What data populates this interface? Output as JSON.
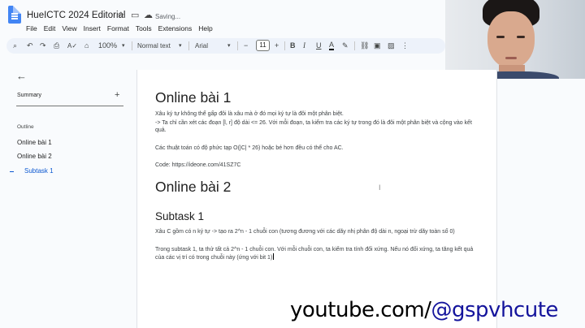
{
  "window": {
    "doc_title": "HueICTC 2024 Editorial",
    "save_status": "Saving...",
    "menu": [
      "File",
      "Edit",
      "View",
      "Insert",
      "Format",
      "Tools",
      "Extensions",
      "Help"
    ]
  },
  "toolbar": {
    "zoom": "100%",
    "style": "Normal text",
    "font": "Arial",
    "font_size": "11",
    "icons": [
      "search-icon",
      "undo-icon",
      "redo-icon",
      "print-icon",
      "spellcheck-icon",
      "paint-format-icon",
      "bold-icon",
      "italic-icon",
      "underline-icon",
      "text-color-icon",
      "highlight-icon",
      "link-icon",
      "comment-icon",
      "image-icon"
    ]
  },
  "sidebar": {
    "summary_label": "Summary",
    "outline_label": "Outline",
    "items": [
      {
        "label": "Online bài 1",
        "active": false
      },
      {
        "label": "Online bài 2",
        "active": false
      },
      {
        "label": "Subtask 1",
        "active": true
      }
    ]
  },
  "document": {
    "h1_a": "Online bài 1",
    "p1": "Xâu ký tự không thể gấp đôi là xâu mà ở đó mọi ký tự là đôi một phân biệt.",
    "p2": "-> Ta chỉ cần xét các đoạn [l, r] độ dài <= 26. Với mỗi đoạn, ta kiểm tra các ký tự trong đó là đôi một phân biệt và cộng vào kết quả.",
    "p3": "Các thuật toán có độ phức tạp O(|C| * 26) hoặc bé hơn đều có thể cho AC.",
    "p4": "Code: https://ideone.com/41SZ7C",
    "h1_b": "Online bài 2",
    "h2": "Subtask 1",
    "p5": "Xâu C gồm có n ký tự -> tạo ra 2^n - 1 chuỗi con (tương đương với các dãy nhị phân độ dài n, ngoại trừ dãy toàn số 0)",
    "p6": "Trong subtask 1, ta thử tất cả 2^n - 1 chuỗi con. Với mỗi chuỗi con, ta kiểm tra tính đối xứng. Nếu nó đối xứng, ta tăng kết quả của các vị trí có trong chuỗi này (ứng với bit 1)"
  },
  "watermark": {
    "part1": "youtube.com/",
    "part2": "@gspvhcute"
  },
  "colors": {
    "accent": "#0b57d0",
    "toolbar_bg": "#edf2fa",
    "page_bg": "#ffffff",
    "app_bg": "#f9fbfd",
    "watermark": "#14149c"
  }
}
